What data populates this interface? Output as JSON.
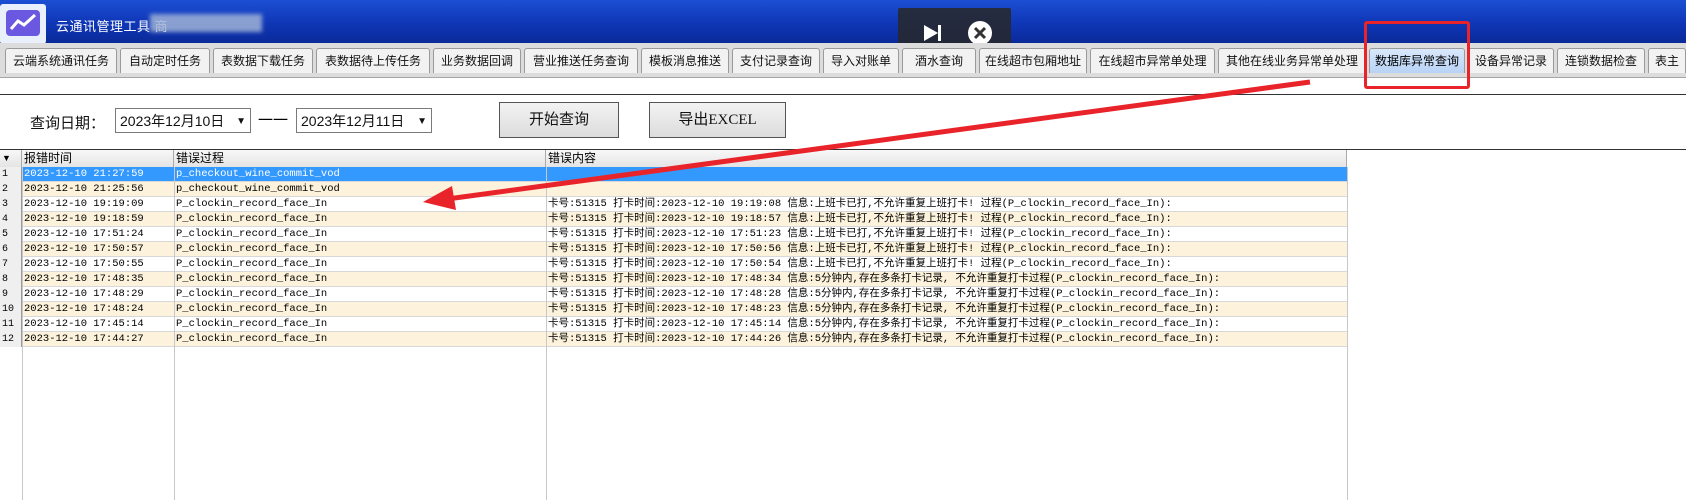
{
  "window": {
    "title": "云通讯管理工具 商"
  },
  "colors": {
    "accent_red": "#e8242a",
    "selected_row": "#3399ff",
    "title_blue": "#0f36b6"
  },
  "overlay_icons": [
    "play-step-icon",
    "close-circle-icon"
  ],
  "tabs": [
    "云端系统通讯任务",
    "自动定时任务",
    "表数据下载任务",
    "表数据待上传任务",
    "业务数据回调",
    "营业推送任务查询",
    "模板消息推送",
    "支付记录查询",
    "导入对账单",
    "酒水查询",
    "在线超市包厢地址",
    "在线超市异常单处理",
    "其他在线业务异常单处理",
    "数据库异常查询",
    "设备异常记录",
    "连锁数据检查",
    "表主"
  ],
  "active_tab": "数据库异常查询",
  "query": {
    "label": "查询日期：",
    "start_date": "2023年12月10日",
    "separator": "一一",
    "end_date": "2023年12月11日",
    "search_button": "开始查询",
    "export_button": "导出EXCEL"
  },
  "table": {
    "columns": [
      "报错时间",
      "错误过程",
      "错误内容"
    ],
    "rows": [
      {
        "n": "1",
        "time": "2023-12-10 21:27:59",
        "proc": "p_checkout_wine_commit_vod",
        "msg": ""
      },
      {
        "n": "2",
        "time": "2023-12-10 21:25:56",
        "proc": "p_checkout_wine_commit_vod",
        "msg": ""
      },
      {
        "n": "3",
        "time": "2023-12-10 19:19:09",
        "proc": "P_clockin_record_face_In",
        "msg": "卡号:51315 打卡时间:2023-12-10 19:19:08 信息:上班卡已打,不允许重复上班打卡! 过程(P_clockin_record_face_In):"
      },
      {
        "n": "4",
        "time": "2023-12-10 19:18:59",
        "proc": "P_clockin_record_face_In",
        "msg": "卡号:51315 打卡时间:2023-12-10 19:18:57 信息:上班卡已打,不允许重复上班打卡! 过程(P_clockin_record_face_In):"
      },
      {
        "n": "5",
        "time": "2023-12-10 17:51:24",
        "proc": "P_clockin_record_face_In",
        "msg": "卡号:51315 打卡时间:2023-12-10 17:51:23 信息:上班卡已打,不允许重复上班打卡! 过程(P_clockin_record_face_In):"
      },
      {
        "n": "6",
        "time": "2023-12-10 17:50:57",
        "proc": "P_clockin_record_face_In",
        "msg": "卡号:51315 打卡时间:2023-12-10 17:50:56 信息:上班卡已打,不允许重复上班打卡! 过程(P_clockin_record_face_In):"
      },
      {
        "n": "7",
        "time": "2023-12-10 17:50:55",
        "proc": "P_clockin_record_face_In",
        "msg": "卡号:51315 打卡时间:2023-12-10 17:50:54 信息:上班卡已打,不允许重复上班打卡! 过程(P_clockin_record_face_In):"
      },
      {
        "n": "8",
        "time": "2023-12-10 17:48:35",
        "proc": "P_clockin_record_face_In",
        "msg": "卡号:51315 打卡时间:2023-12-10 17:48:34 信息:5分钟内,存在多条打卡记录, 不允许重复打卡过程(P_clockin_record_face_In):"
      },
      {
        "n": "9",
        "time": "2023-12-10 17:48:29",
        "proc": "P_clockin_record_face_In",
        "msg": "卡号:51315 打卡时间:2023-12-10 17:48:28 信息:5分钟内,存在多条打卡记录, 不允许重复打卡过程(P_clockin_record_face_In):"
      },
      {
        "n": "10",
        "time": "2023-12-10 17:48:24",
        "proc": "P_clockin_record_face_In",
        "msg": "卡号:51315 打卡时间:2023-12-10 17:48:23 信息:5分钟内,存在多条打卡记录, 不允许重复打卡过程(P_clockin_record_face_In):"
      },
      {
        "n": "11",
        "time": "2023-12-10 17:45:14",
        "proc": "P_clockin_record_face_In",
        "msg": "卡号:51315 打卡时间:2023-12-10 17:45:14 信息:5分钟内,存在多条打卡记录, 不允许重复打卡过程(P_clockin_record_face_In):"
      },
      {
        "n": "12",
        "time": "2023-12-10 17:44:27",
        "proc": "P_clockin_record_face_In",
        "msg": "卡号:51315 打卡时间:2023-12-10 17:44:26 信息:5分钟内,存在多条打卡记录, 不允许重复打卡过程(P_clockin_record_face_In):"
      }
    ]
  }
}
